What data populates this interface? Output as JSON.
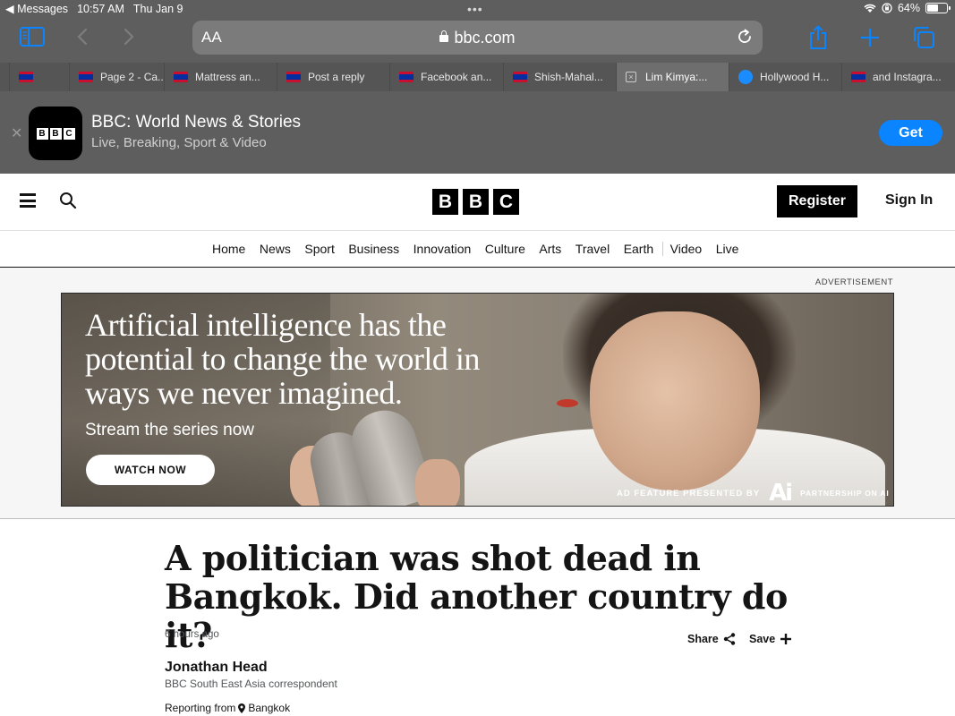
{
  "status_bar": {
    "back_app": "◀ Messages",
    "time": "10:57 AM",
    "date": "Thu Jan 9",
    "multitask_dots": "•••",
    "battery_pct": "64%",
    "battery_level": 0.64
  },
  "safari": {
    "address": {
      "text_size_label": "AA",
      "domain": "bbc.com"
    },
    "tabs": [
      {
        "label": "",
        "favicon": "khmer-flag"
      },
      {
        "label": "Page 2 - Ca...",
        "favicon": "khmer-flag"
      },
      {
        "label": "Mattress an...",
        "favicon": "khmer-flag"
      },
      {
        "label": "Post a reply",
        "favicon": "khmer-flag"
      },
      {
        "label": "Facebook an...",
        "favicon": "khmer-flag"
      },
      {
        "label": "Shish-Mahal...",
        "favicon": "khmer-flag"
      },
      {
        "label": "Lim Kimya:...",
        "favicon": "close-box",
        "active": true
      },
      {
        "label": "Hollywood H...",
        "favicon": "blue-circle"
      },
      {
        "label": "and Instagra...",
        "favicon": "khmer-flag"
      }
    ]
  },
  "app_banner": {
    "title": "BBC: World News & Stories",
    "subtitle": "Live, Breaking, Sport & Video",
    "get_label": "Get",
    "icon_letters": [
      "B",
      "B",
      "C"
    ]
  },
  "bbc": {
    "logo_letters": [
      "B",
      "B",
      "C"
    ],
    "register_label": "Register",
    "signin_label": "Sign In",
    "nav": [
      "Home",
      "News",
      "Sport",
      "Business",
      "Innovation",
      "Culture",
      "Arts",
      "Travel",
      "Earth",
      "Video",
      "Live"
    ]
  },
  "ad": {
    "label": "ADVERTISEMENT",
    "headline": "Artificial intelligence has the potential to change the world in ways we never imagined.",
    "subline": "Stream the series now",
    "cta": "WATCH NOW",
    "feature_label": "AD FEATURE PRESENTED BY",
    "partner_logo_text": "Ai",
    "partner_name": "PARTNERSHIP ON AI"
  },
  "article": {
    "headline": "A politician was shot dead in Bangkok. Did another country do it?",
    "time_ago": "6 hours ago",
    "share_label": "Share",
    "save_label": "Save",
    "author": "Jonathan Head",
    "author_role": "BBC South East Asia correspondent",
    "reporting_prefix": "Reporting from",
    "reporting_location": "Bangkok"
  },
  "colors": {
    "safari_accent": "#0a84ff",
    "chrome_bg": "#5e5e5e",
    "bbc_black": "#000000"
  }
}
